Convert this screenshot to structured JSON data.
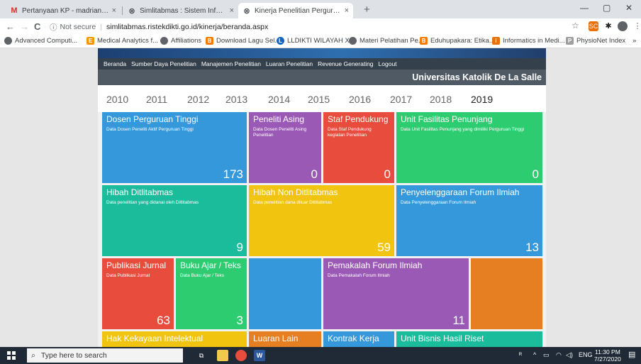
{
  "browser": {
    "tabs": [
      {
        "favicon": "M",
        "label": "Pertanyaan KP - madrian@unika..."
      },
      {
        "favicon": "⊗",
        "label": "Simlitabmas : Sistem Informasi P..."
      },
      {
        "favicon": "⊗",
        "label": "Kinerja Penelitian Perguruan Ting..."
      }
    ],
    "tab_close": "×",
    "new_tab": "+",
    "window_controls": [
      "—",
      "▢",
      "✕"
    ],
    "nav": {
      "back": "←",
      "forward": "→",
      "reload": "C"
    },
    "security_label": "Not secure",
    "url": "simlitabmas.ristekdikti.go.id/kinerja/beranda.aspx",
    "bookmarks": [
      {
        "icon": "globe-icon",
        "label": "Advanced Computi..."
      },
      {
        "icon": "E",
        "label": "Medical Analytics f..."
      },
      {
        "icon": "globe-icon",
        "label": "Affiliations"
      },
      {
        "icon": "B",
        "label": "Download Lagu Sel..."
      },
      {
        "icon": "L",
        "label": "LLDIKTI WILAYAH X..."
      },
      {
        "icon": "globe-icon",
        "label": "Materi Pelatihan Pe..."
      },
      {
        "icon": "B",
        "label": "Eduhupakara: Etika..."
      },
      {
        "icon": "i",
        "label": "Informatics in Medi..."
      },
      {
        "icon": "P",
        "label": "PhysioNet Index"
      }
    ],
    "bookmarks_more": "»"
  },
  "page": {
    "menu": [
      "Beranda",
      "Sumber Daya Penelitian",
      "Manajemen Penelitian",
      "Luaran Penelitian",
      "Revenue Generating",
      "Logout"
    ],
    "university": "Universitas Katolik De La Salle",
    "years": [
      "2010",
      "2011",
      "2012",
      "2013",
      "2014",
      "2015",
      "2016",
      "2017",
      "2018",
      "2019"
    ],
    "selected_year": "2019",
    "tiles": {
      "dosen": {
        "title": "Dosen Perguruan Tinggi",
        "subtitle": "Data Dosen Peneliti Aktif Perguruan Tinggi",
        "value": "173"
      },
      "asing": {
        "title": "Peneliti Asing",
        "subtitle": "Data Dosen Peneliti Asing Penelitian",
        "value": "0"
      },
      "staf": {
        "title": "Staf Pendukung",
        "subtitle": "Data Staf Pendukung kegiatan Penelitian",
        "value": "0"
      },
      "fasilitas": {
        "title": "Unit Fasilitas Penunjang",
        "subtitle": "Data Unit Fasilitas Penunjang yang dimiliki Perguruan Tinggi",
        "value": "0"
      },
      "hibah": {
        "title": "Hibah Ditlitabmas",
        "subtitle": "Data penelitian yang didanai oleh Ditlitabmas",
        "value": "9"
      },
      "hibah_non": {
        "title": "Hibah Non Ditlitabmas",
        "subtitle": "Data penelitian dana diluar Ditlitabmas",
        "value": "59"
      },
      "forum": {
        "title": "Penyelenggaraan Forum Ilmiah",
        "subtitle": "Data Penyelenggaraan Forum Ilmiah",
        "value": "13"
      },
      "jurnal": {
        "title": "Publikasi Jurnal",
        "subtitle": "Data Publikasi Jurnal",
        "value": "63"
      },
      "buku": {
        "title": "Buku Ajar / Teks",
        "subtitle": "Data Buku Ajar / Teks",
        "value": "3"
      },
      "pemakalah": {
        "title": "Pemakalah Forum Ilmiah",
        "subtitle": "Data Pemakalah Forum Ilmiah",
        "value": "11"
      },
      "hki": {
        "title": "Hak Kekayaan Intelektual"
      },
      "luaran": {
        "title": "Luaran Lain"
      },
      "kontrak": {
        "title": "Kontrak Kerja"
      },
      "bisnis": {
        "title": "Unit Bisnis Hasil Riset"
      }
    },
    "colors": {
      "blue": "#3498db",
      "purple": "#9b59b6",
      "red": "#e74c3c",
      "green": "#2ecc71",
      "teal": "#1abc9c",
      "yellow": "#f1c40f",
      "orange": "#e67e22"
    }
  },
  "taskbar": {
    "search_placeholder": "Type here to search",
    "tray_language": "ENG",
    "time": "11:30 PM",
    "date": "7/27/2020"
  }
}
